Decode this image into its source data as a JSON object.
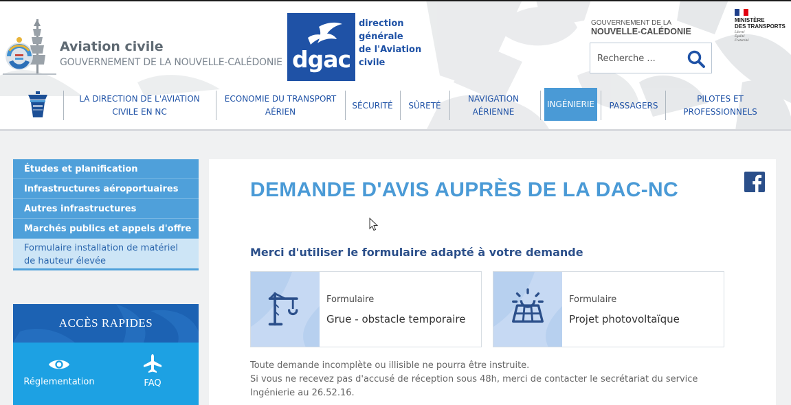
{
  "header": {
    "logo": {
      "title": "Aviation civile",
      "subtitle": "GOUVERNEMENT DE LA NOUVELLE-CALÉDONIE"
    },
    "dgac": {
      "acronym": "dgac",
      "line1": "direction",
      "line2": "générale",
      "line3": "de l'Aviation",
      "line4": "civile"
    },
    "gov_nc": {
      "line1": "GOUVERNEMENT DE LA",
      "line2": "NOUVELLE-CALÉDONIE"
    },
    "ministere": {
      "line1": "MINISTÈRE",
      "line2": "DES TRANSPORTS",
      "motto1": "Liberté",
      "motto2": "Égalité",
      "motto3": "Fraternité"
    },
    "search": {
      "placeholder": "Recherche ...",
      "value": ""
    }
  },
  "nav": {
    "items": [
      {
        "line1": "LA DIRECTION DE L'AVIATION",
        "line2": "CIVILE EN NC"
      },
      {
        "line1": "ECONOMIE DU TRANSPORT",
        "line2": "AÉRIEN"
      },
      {
        "line1": "SÉCURITÉ",
        "line2": ""
      },
      {
        "line1": "SÛRETÉ",
        "line2": ""
      },
      {
        "line1": "NAVIGATION",
        "line2": "AÉRIENNE"
      },
      {
        "line1": "INGÉNIERIE",
        "line2": ""
      },
      {
        "line1": "PASSAGERS",
        "line2": ""
      },
      {
        "line1": "PILOTES ET",
        "line2": "PROFESSIONNELS"
      }
    ],
    "active_index": 5
  },
  "sidebar": {
    "items": [
      {
        "line1": "Études et planification",
        "line2": ""
      },
      {
        "line1": "Infrastructures aéroportuaires",
        "line2": ""
      },
      {
        "line1": "Autres infrastructures",
        "line2": ""
      },
      {
        "line1": "Marchés publics et appels d'offre",
        "line2": ""
      },
      {
        "line1": "Formulaire installation de matériel",
        "line2": "de hauteur élevée"
      }
    ],
    "quick_access": {
      "title": "ACCÈS RAPIDES",
      "links": [
        {
          "label": "Réglementation",
          "icon": "eye-icon"
        },
        {
          "label": "FAQ",
          "icon": "airplane-icon"
        }
      ]
    }
  },
  "main": {
    "title": "DEMANDE D'AVIS AUPRÈS DE LA DAC-NC",
    "subtitle": "Merci d'utiliser le formulaire adapté à votre demande",
    "cards": [
      {
        "kicker": "Formulaire",
        "title": "Grue - obstacle temporaire",
        "icon": "crane-icon"
      },
      {
        "kicker": "Formulaire",
        "title": "Projet photovoltaïque",
        "icon": "solar-panel-icon"
      }
    ],
    "info": {
      "line1": "Toute demande incomplète ou illisible ne pourra être instruite.",
      "line2": "Si vous ne recevez pas d'accusé de réception sous 48h, merci de contacter le secrétariat du service",
      "line3": "Ingénierie au 26.52.16."
    }
  },
  "colors": {
    "brand_blue": "#1f52a6",
    "accent_blue": "#4a9ad6",
    "sidebar_blue": "#4fa0da",
    "quick_access_head": "#1c62b3",
    "quick_access_body": "#1da1e3"
  }
}
